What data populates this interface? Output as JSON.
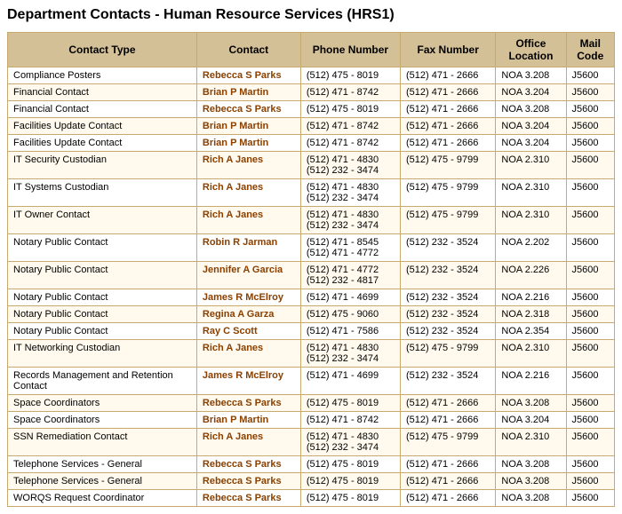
{
  "title": "Department Contacts - Human Resource Services (HRS1)",
  "columns": [
    "Contact Type",
    "Contact",
    "Phone Number",
    "Fax Number",
    "Office Location",
    "Mail Code"
  ],
  "rows": [
    {
      "type": "Compliance Posters",
      "contact": "Rebecca S Parks",
      "phone": "(512) 475 - 8019",
      "fax": "(512) 471 - 2666",
      "office": "NOA 3.208",
      "mail": "J5600"
    },
    {
      "type": "Financial Contact",
      "contact": "Brian P Martin",
      "phone": "(512) 471 - 8742",
      "fax": "(512) 471 - 2666",
      "office": "NOA 3.204",
      "mail": "J5600"
    },
    {
      "type": "Financial Contact",
      "contact": "Rebecca S Parks",
      "phone": "(512) 475 - 8019",
      "fax": "(512) 471 - 2666",
      "office": "NOA 3.208",
      "mail": "J5600"
    },
    {
      "type": "Facilities Update Contact",
      "contact": "Brian P Martin",
      "phone": "(512) 471 - 8742",
      "fax": "(512) 471 - 2666",
      "office": "NOA 3.204",
      "mail": "J5600"
    },
    {
      "type": "Facilities Update Contact",
      "contact": "Brian P Martin",
      "phone": "(512) 471 - 8742",
      "fax": "(512) 471 - 2666",
      "office": "NOA 3.204",
      "mail": "J5600"
    },
    {
      "type": "IT Security Custodian",
      "contact": "Rich A Janes",
      "phone": "(512) 471 - 4830\n(512) 232 - 3474",
      "fax": "(512) 475 - 9799",
      "office": "NOA 2.310",
      "mail": "J5600"
    },
    {
      "type": "IT Systems Custodian",
      "contact": "Rich A Janes",
      "phone": "(512) 471 - 4830\n(512) 232 - 3474",
      "fax": "(512) 475 - 9799",
      "office": "NOA 2.310",
      "mail": "J5600"
    },
    {
      "type": "IT Owner Contact",
      "contact": "Rich A Janes",
      "phone": "(512) 471 - 4830\n(512) 232 - 3474",
      "fax": "(512) 475 - 9799",
      "office": "NOA 2.310",
      "mail": "J5600"
    },
    {
      "type": "Notary Public Contact",
      "contact": "Robin R Jarman",
      "phone": "(512) 471 - 8545\n(512) 471 - 4772",
      "fax": "(512) 232 - 3524",
      "office": "NOA 2.202",
      "mail": "J5600"
    },
    {
      "type": "Notary Public Contact",
      "contact": "Jennifer A Garcia",
      "phone": "(512) 471 - 4772\n(512) 232 - 4817",
      "fax": "(512) 232 - 3524",
      "office": "NOA 2.226",
      "mail": "J5600"
    },
    {
      "type": "Notary Public Contact",
      "contact": "James R McElroy",
      "phone": "(512) 471 - 4699",
      "fax": "(512) 232 - 3524",
      "office": "NOA 2.216",
      "mail": "J5600"
    },
    {
      "type": "Notary Public Contact",
      "contact": "Regina A Garza",
      "phone": "(512) 475 - 9060",
      "fax": "(512) 232 - 3524",
      "office": "NOA 2.318",
      "mail": "J5600"
    },
    {
      "type": "Notary Public Contact",
      "contact": "Ray C Scott",
      "phone": "(512) 471 - 7586",
      "fax": "(512) 232 - 3524",
      "office": "NOA 2.354",
      "mail": "J5600"
    },
    {
      "type": "IT Networking Custodian",
      "contact": "Rich A Janes",
      "phone": "(512) 471 - 4830\n(512) 232 - 3474",
      "fax": "(512) 475 - 9799",
      "office": "NOA 2.310",
      "mail": "J5600"
    },
    {
      "type": "Records Management and Retention Contact",
      "contact": "James R McElroy",
      "phone": "(512) 471 - 4699",
      "fax": "(512) 232 - 3524",
      "office": "NOA 2.216",
      "mail": "J5600"
    },
    {
      "type": "Space Coordinators",
      "contact": "Rebecca S Parks",
      "phone": "(512) 475 - 8019",
      "fax": "(512) 471 - 2666",
      "office": "NOA 3.208",
      "mail": "J5600"
    },
    {
      "type": "Space Coordinators",
      "contact": "Brian P Martin",
      "phone": "(512) 471 - 8742",
      "fax": "(512) 471 - 2666",
      "office": "NOA 3.204",
      "mail": "J5600"
    },
    {
      "type": "SSN Remediation Contact",
      "contact": "Rich A Janes",
      "phone": "(512) 471 - 4830\n(512) 232 - 3474",
      "fax": "(512) 475 - 9799",
      "office": "NOA 2.310",
      "mail": "J5600"
    },
    {
      "type": "Telephone Services - General",
      "contact": "Rebecca S Parks",
      "phone": "(512) 475 - 8019",
      "fax": "(512) 471 - 2666",
      "office": "NOA 3.208",
      "mail": "J5600"
    },
    {
      "type": "Telephone Services - General",
      "contact": "Rebecca S Parks",
      "phone": "(512) 475 - 8019",
      "fax": "(512) 471 - 2666",
      "office": "NOA 3.208",
      "mail": "J5600"
    },
    {
      "type": "WORQS Request Coordinator",
      "contact": "Rebecca S Parks",
      "phone": "(512) 475 - 8019",
      "fax": "(512) 471 - 2666",
      "office": "NOA 3.208",
      "mail": "J5600"
    }
  ]
}
